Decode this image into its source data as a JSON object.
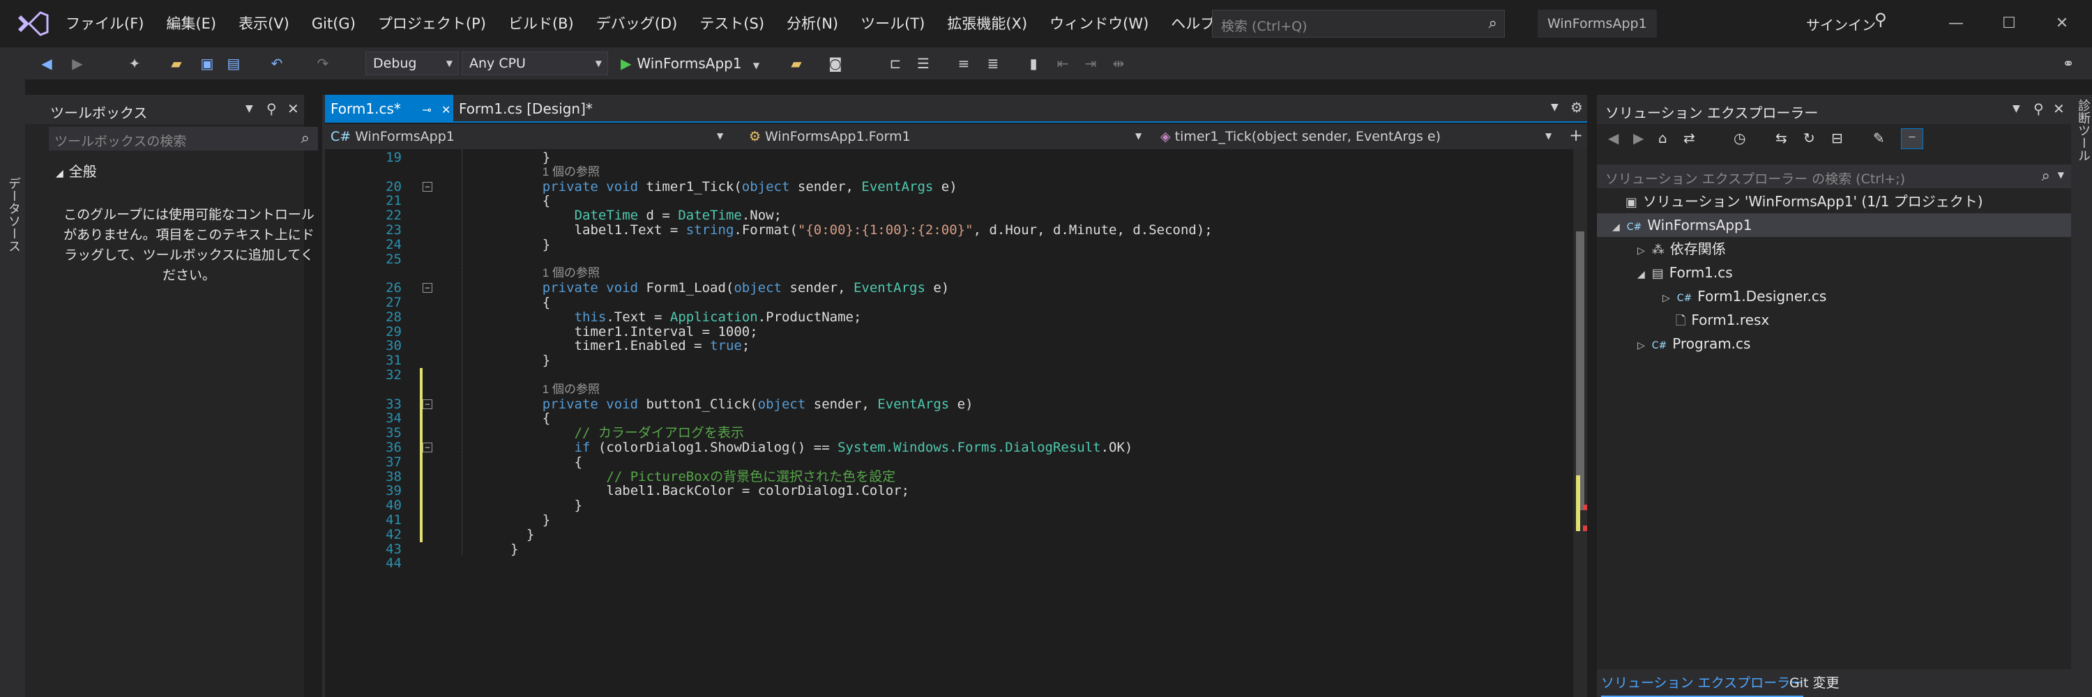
{
  "menubar": {
    "items": [
      "ファイル(F)",
      "編集(E)",
      "表示(V)",
      "Git(G)",
      "プロジェクト(P)",
      "ビルド(B)",
      "デバッグ(D)",
      "テスト(S)",
      "分析(N)",
      "ツール(T)",
      "拡張機能(X)",
      "ウィンドウ(W)",
      "ヘルプ(H)"
    ],
    "search_placeholder": "検索 (Ctrl+Q)",
    "window_title": "WinFormsApp1",
    "signin": "サインイン"
  },
  "toolbar": {
    "config": "Debug",
    "platform": "Any CPU",
    "run_label": "WinFormsApp1"
  },
  "left_strip": {
    "tab": "データソース"
  },
  "toolbox": {
    "title": "ツールボックス",
    "search_placeholder": "ツールボックスの検索",
    "group": "全般",
    "empty_text": "このグループには使用可能なコントロールがありません。項目をこのテキスト上にドラッグして、ツールボックスに追加してください。"
  },
  "editor": {
    "tabs": [
      {
        "label": "Form1.cs*"
      },
      {
        "label": "Form1.cs [Design]*"
      }
    ],
    "nav": {
      "project": "WinFormsApp1",
      "class": "WinFormsApp1.Form1",
      "member": "timer1_Tick(object sender, EventArgs e)"
    },
    "ref_label": "1 個の参照",
    "lines": [
      {
        "n": "19",
        "indent": 4,
        "parts": [
          [
            "",
            "}"
          ]
        ]
      },
      {
        "n": "",
        "indent": 4,
        "ref": true
      },
      {
        "n": "20",
        "indent": 4,
        "fold": true,
        "parts": [
          [
            "kw",
            "private void "
          ],
          [
            "",
            "timer1_Tick("
          ],
          [
            "kw",
            "object"
          ],
          [
            "",
            " sender, "
          ],
          [
            "ty",
            "EventArgs"
          ],
          [
            "",
            " e)"
          ]
        ]
      },
      {
        "n": "21",
        "indent": 4,
        "parts": [
          [
            "",
            "{"
          ]
        ]
      },
      {
        "n": "22",
        "indent": 8,
        "parts": [
          [
            "ty",
            "DateTime"
          ],
          [
            "",
            " d = "
          ],
          [
            "ty",
            "DateTime"
          ],
          [
            "",
            ".Now;"
          ]
        ]
      },
      {
        "n": "23",
        "indent": 8,
        "parts": [
          [
            "",
            "label1.Text = "
          ],
          [
            "kw",
            "string"
          ],
          [
            "",
            ".Format("
          ],
          [
            "st",
            "\"{0:00}:{1:00}:{2:00}\""
          ],
          [
            "",
            ", d.Hour, d.Minute, d.Second);"
          ]
        ]
      },
      {
        "n": "24",
        "indent": 4,
        "parts": [
          [
            "",
            "}"
          ]
        ]
      },
      {
        "n": "25",
        "indent": 0,
        "parts": []
      },
      {
        "n": "",
        "indent": 4,
        "ref": true
      },
      {
        "n": "26",
        "indent": 4,
        "fold": true,
        "parts": [
          [
            "kw",
            "private void "
          ],
          [
            "",
            "Form1_Load("
          ],
          [
            "kw",
            "object"
          ],
          [
            "",
            " sender, "
          ],
          [
            "ty",
            "EventArgs"
          ],
          [
            "",
            " e)"
          ]
        ]
      },
      {
        "n": "27",
        "indent": 4,
        "parts": [
          [
            "",
            "{"
          ]
        ]
      },
      {
        "n": "28",
        "indent": 8,
        "parts": [
          [
            "kw",
            "this"
          ],
          [
            "",
            ".Text = "
          ],
          [
            "ty",
            "Application"
          ],
          [
            "",
            ".ProductName;"
          ]
        ]
      },
      {
        "n": "29",
        "indent": 8,
        "parts": [
          [
            "",
            "timer1.Interval = 1000;"
          ]
        ]
      },
      {
        "n": "30",
        "indent": 8,
        "parts": [
          [
            "",
            "timer1.Enabled = "
          ],
          [
            "kw",
            "true"
          ],
          [
            "",
            ";"
          ]
        ]
      },
      {
        "n": "31",
        "indent": 4,
        "parts": [
          [
            "",
            "}"
          ]
        ]
      },
      {
        "n": "32",
        "indent": 0,
        "parts": []
      },
      {
        "n": "",
        "indent": 4,
        "ref": true
      },
      {
        "n": "33",
        "indent": 4,
        "fold": true,
        "parts": [
          [
            "kw",
            "private void "
          ],
          [
            "",
            "button1_Click("
          ],
          [
            "kw",
            "object"
          ],
          [
            "",
            " sender, "
          ],
          [
            "ty",
            "EventArgs"
          ],
          [
            "",
            " e)"
          ]
        ]
      },
      {
        "n": "34",
        "indent": 4,
        "parts": [
          [
            "",
            "{"
          ]
        ]
      },
      {
        "n": "35",
        "indent": 8,
        "parts": [
          [
            "cm",
            "// カラーダイアログを表示"
          ]
        ]
      },
      {
        "n": "36",
        "indent": 8,
        "fold": true,
        "parts": [
          [
            "kw",
            "if"
          ],
          [
            "",
            " (colorDialog1.ShowDialog() == "
          ],
          [
            "ty",
            "System.Windows.Forms.DialogResult"
          ],
          [
            "",
            ".OK)"
          ]
        ]
      },
      {
        "n": "37",
        "indent": 8,
        "parts": [
          [
            "",
            "{"
          ]
        ]
      },
      {
        "n": "38",
        "indent": 12,
        "parts": [
          [
            "cm",
            "// PictureBoxの背景色に選択された色を設定"
          ]
        ]
      },
      {
        "n": "39",
        "indent": 12,
        "parts": [
          [
            "",
            "label1.BackColor = colorDialog1.Color;"
          ]
        ]
      },
      {
        "n": "40",
        "indent": 8,
        "parts": [
          [
            "",
            "}"
          ]
        ]
      },
      {
        "n": "41",
        "indent": 4,
        "parts": [
          [
            "",
            "}"
          ]
        ]
      },
      {
        "n": "42",
        "indent": 2,
        "parts": [
          [
            "",
            "}"
          ]
        ]
      },
      {
        "n": "43",
        "indent": 0,
        "parts": [
          [
            "",
            "}"
          ]
        ]
      },
      {
        "n": "44",
        "indent": 0,
        "parts": []
      }
    ]
  },
  "solution_explorer": {
    "title": "ソリューション エクスプローラー",
    "search_placeholder": "ソリューション エクスプローラー の検索 (Ctrl+;)",
    "items": [
      {
        "label": "ソリューション 'WinFormsApp1' (1/1 プロジェクト)",
        "depth": 0,
        "arrow": "",
        "icon": "▣"
      },
      {
        "label": "WinFormsApp1",
        "depth": 0,
        "arrow": "◢",
        "icon": "C#"
      },
      {
        "label": "依存関係",
        "depth": 1,
        "arrow": "▷",
        "icon": "⁂"
      },
      {
        "label": "Form1.cs",
        "depth": 1,
        "arrow": "◢",
        "icon": "▤"
      },
      {
        "label": "Form1.Designer.cs",
        "depth": 2,
        "arrow": "▷",
        "icon": "C#"
      },
      {
        "label": "Form1.resx",
        "depth": 2,
        "arrow": "",
        "icon": "🗋"
      },
      {
        "label": "Program.cs",
        "depth": 1,
        "arrow": "▷",
        "icon": "C#"
      }
    ],
    "footer_tabs": [
      "ソリューション エクスプローラー",
      "Git 変更"
    ]
  },
  "right_strip": {
    "tab": "診断ツール"
  },
  "colors": {
    "accent": "#007acc",
    "keyword": "#569cd6",
    "type": "#4ec9b0",
    "string": "#d69d85",
    "comment": "#57a64a",
    "line_number": "#2b91af"
  }
}
